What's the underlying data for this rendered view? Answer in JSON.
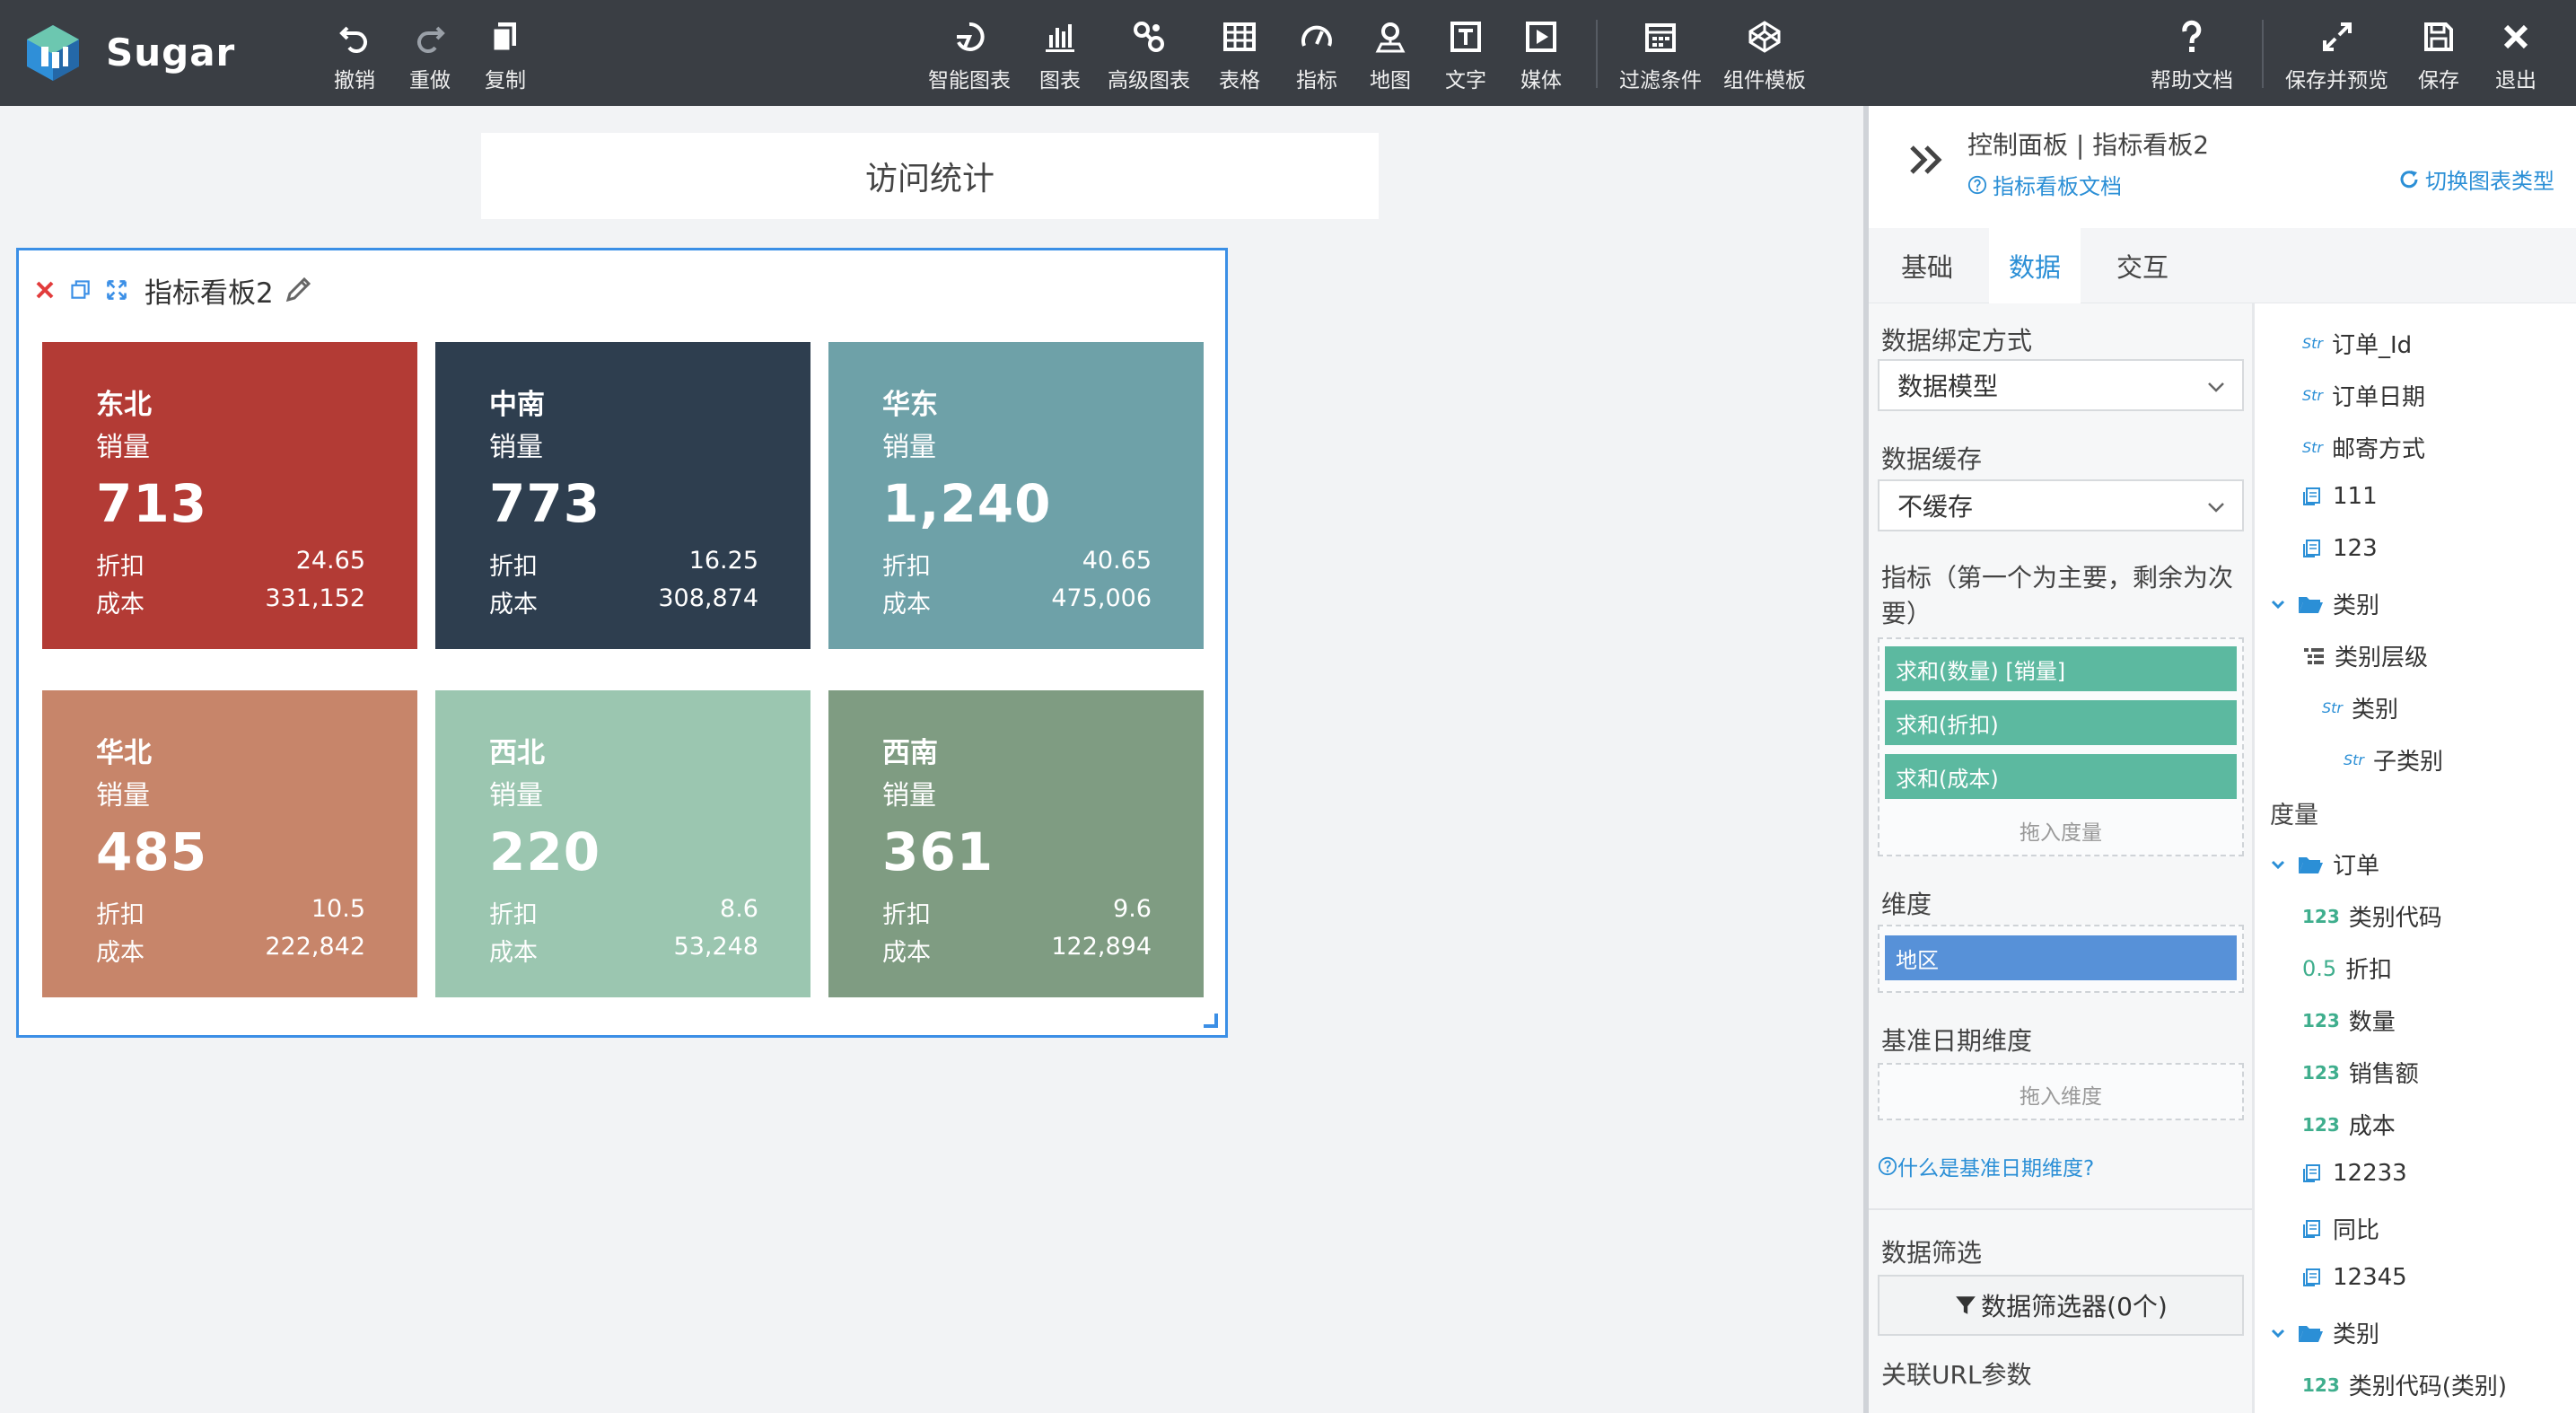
{
  "app": {
    "brand": "Sugar"
  },
  "toolbar": {
    "undo": "撤销",
    "redo": "重做",
    "copy": "复制",
    "smart_chart": "智能图表",
    "chart": "图表",
    "adv_chart": "高级图表",
    "table": "表格",
    "indicator": "指标",
    "map": "地图",
    "text": "文字",
    "media": "媒体",
    "filter_cond": "过滤条件",
    "comp_template": "组件模板",
    "help": "帮助文档",
    "save_preview": "保存并预览",
    "save": "保存",
    "exit": "退出"
  },
  "canvas": {
    "page_title": "访问统计",
    "widget_title": "指标看板2"
  },
  "cards": [
    {
      "region": "东北",
      "metric": "销量",
      "value": "713",
      "discount_label": "折扣",
      "discount": "24.65",
      "cost_label": "成本",
      "cost": "331,152",
      "color": "#b33b35"
    },
    {
      "region": "中南",
      "metric": "销量",
      "value": "773",
      "discount_label": "折扣",
      "discount": "16.25",
      "cost_label": "成本",
      "cost": "308,874",
      "color": "#2e3e4f"
    },
    {
      "region": "华东",
      "metric": "销量",
      "value": "1,240",
      "discount_label": "折扣",
      "discount": "40.65",
      "cost_label": "成本",
      "cost": "475,006",
      "color": "#6ea1a8"
    },
    {
      "region": "华北",
      "metric": "销量",
      "value": "485",
      "discount_label": "折扣",
      "discount": "10.5",
      "cost_label": "成本",
      "cost": "222,842",
      "color": "#c7856a"
    },
    {
      "region": "西北",
      "metric": "销量",
      "value": "220",
      "discount_label": "折扣",
      "discount": "8.6",
      "cost_label": "成本",
      "cost": "53,248",
      "color": "#9bc6b0"
    },
    {
      "region": "西南",
      "metric": "销量",
      "value": "361",
      "discount_label": "折扣",
      "discount": "9.6",
      "cost_label": "成本",
      "cost": "122,894",
      "color": "#7f9c82"
    }
  ],
  "panel": {
    "title": "控制面板 | 指标看板2",
    "doc_link": "指标看板文档",
    "switch_type": "切换图表类型",
    "tabs": [
      "基础",
      "数据",
      "交互"
    ],
    "active_tab": "数据",
    "bind_label": "数据绑定方式",
    "bind_value": "数据模型",
    "cache_label": "数据缓存",
    "cache_value": "不缓存",
    "measures_label_1": "指标（第一个为主要，剩余为次",
    "measures_label_2": "要）",
    "measures": [
      "求和(数量) [销量]",
      "求和(折扣)",
      "求和(成本)"
    ],
    "drop_measure": "拖入度量",
    "dimension_label": "维度",
    "dimension": "地区",
    "date_dim_label": "基准日期维度",
    "drop_dimension": "拖入维度",
    "date_dim_help": "什么是基准日期维度?",
    "filter_label": "数据筛选",
    "filter_button": "数据筛选器(0个)",
    "url_param_label": "关联URL参数"
  },
  "fields": {
    "items_top": [
      {
        "type": "Str",
        "name": "订单_Id"
      },
      {
        "type": "Str",
        "name": "订单日期"
      },
      {
        "type": "Str",
        "name": "邮寄方式"
      },
      {
        "type": "calc",
        "name": "111"
      },
      {
        "type": "calc",
        "name": "123"
      }
    ],
    "folder_category": "类别",
    "category_hierarchy": "类别层级",
    "category_str": "类别",
    "subcategory_str": "子类别",
    "measures_group": "度量",
    "folder_order": "订单",
    "order_fields": [
      {
        "type": "123",
        "name": "类别代码"
      },
      {
        "type": "0.5",
        "name": "折扣"
      },
      {
        "type": "123",
        "name": "数量"
      },
      {
        "type": "123",
        "name": "销售额"
      },
      {
        "type": "123",
        "name": "成本"
      },
      {
        "type": "calc",
        "name": "12233"
      },
      {
        "type": "calc",
        "name": "同比"
      },
      {
        "type": "calc",
        "name": "12345"
      }
    ],
    "folder_category_2": "类别",
    "cat_code_field": "类别代码(类别)",
    "str_tag": "Str",
    "num_tag": "123",
    "dec_tag": "0.5"
  }
}
